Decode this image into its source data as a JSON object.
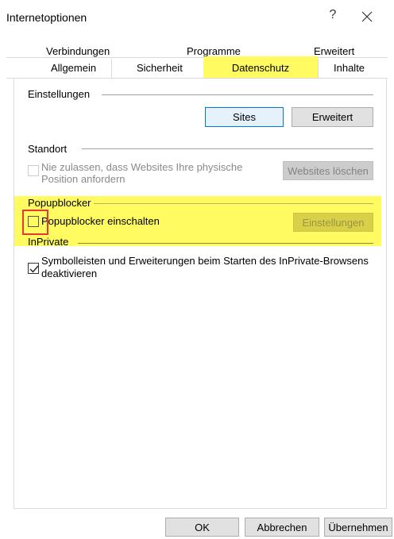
{
  "window": {
    "title": "Internetoptionen",
    "help_label": "?"
  },
  "tabs": {
    "row1": [
      "Verbindungen",
      "Programme",
      "Erweitert"
    ],
    "row2": [
      "Allgemein",
      "Sicherheit",
      "Datenschutz",
      "Inhalte"
    ],
    "active": "Datenschutz"
  },
  "settings": {
    "group_label": "Einstellungen",
    "sites_button": "Sites",
    "advanced_button": "Erweitert"
  },
  "location": {
    "group_label": "Standort",
    "checkbox_line1": "Nie zulassen, dass Websites Ihre physische",
    "checkbox_line2": "Position anfordern",
    "checkbox_checked": false,
    "clear_sites_button": "Websites löschen"
  },
  "popup": {
    "group_label": "Popupblocker",
    "checkbox_label": "Popupblocker einschalten",
    "checkbox_checked": false,
    "settings_button": "Einstellungen"
  },
  "inprivate": {
    "group_label": "InPrivate",
    "checkbox_line1": "Symbolleisten und Erweiterungen beim Starten des InPrivate-Browsens",
    "checkbox_line2": "deaktivieren",
    "checkbox_checked": true
  },
  "footer": {
    "ok_button": "OK",
    "cancel_button": "Abbrechen",
    "apply_button": "Übernehmen"
  },
  "colors": {
    "highlight": "#fffb60",
    "focus_red": "#e53935",
    "accent_blue": "#0078d7"
  }
}
